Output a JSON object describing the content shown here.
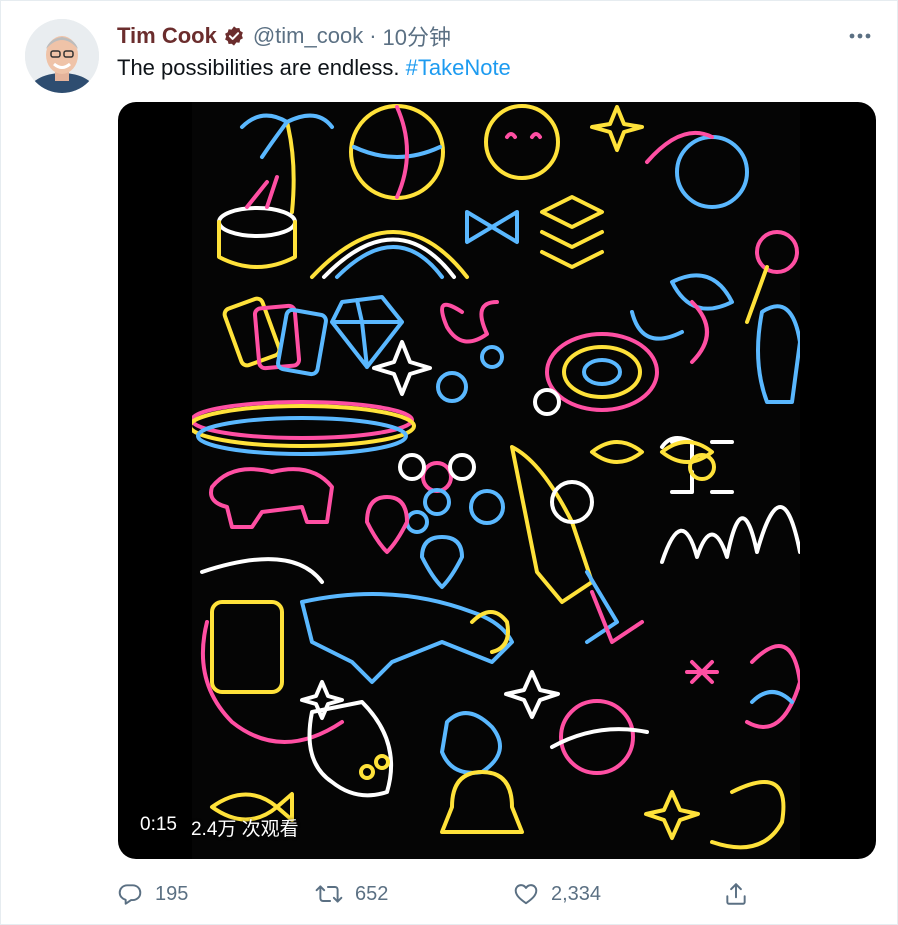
{
  "tweet": {
    "author_name": "Tim Cook",
    "handle": "@tim_cook",
    "separator": "·",
    "time": "10分钟",
    "text_plain": "The possibilities are endless.",
    "hashtag": "#TakeNote"
  },
  "video": {
    "duration": "0:15",
    "views": "2.4万 次观看"
  },
  "actions": {
    "reply_count": "195",
    "retweet_count": "652",
    "like_count": "2,334"
  },
  "icons": {
    "verified": "verified-badge-icon",
    "more": "more-options-icon",
    "reply": "reply-icon",
    "retweet": "retweet-icon",
    "like": "heart-icon",
    "share": "share-icon"
  },
  "colors": {
    "name": "#6b2d2d",
    "secondary": "#5b7083",
    "link": "#1d9bf0",
    "neon_pink": "#ff4fa3",
    "neon_yellow": "#ffe23a",
    "neon_blue": "#5ab8ff"
  }
}
